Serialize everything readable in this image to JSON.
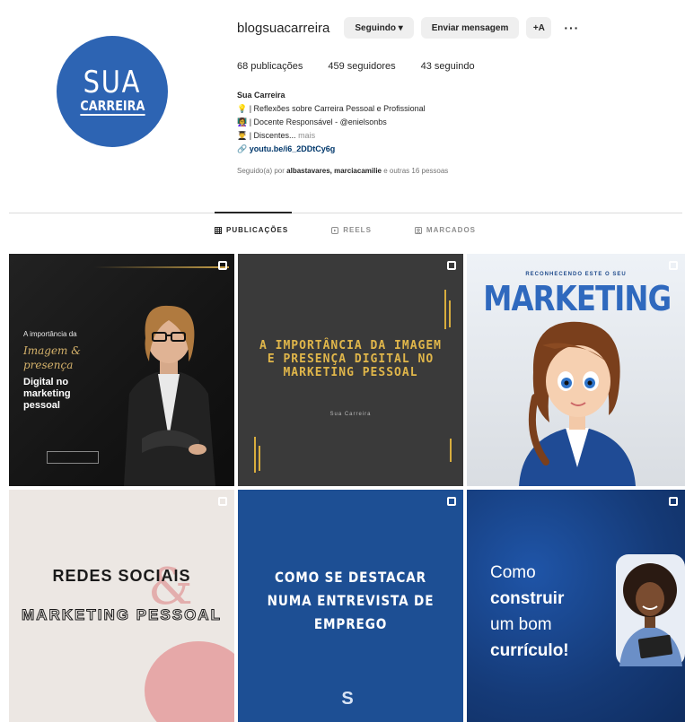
{
  "profile": {
    "avatar_top": "SUA",
    "avatar_bottom": "CARREIRA",
    "username": "blogsuacarreira",
    "following_btn": "Seguindo ▾",
    "message_btn": "Enviar mensagem",
    "add_user_icon": "+A",
    "more_icon": "···",
    "stats": {
      "posts": "68 publicações",
      "followers": "459 seguidores",
      "following": "43 seguindo"
    },
    "bio": {
      "name": "Sua Carreira",
      "line1": "💡 | Reflexões sobre Carreira Pessoal e Profissional",
      "line2": "👩‍🏫 | Docente Responsável - @enielsonbs",
      "line3_prefix": "👨‍🎓 | Discentes... ",
      "line3_more": "mais",
      "link": "🔗 youtu.be/i6_2DDtCy6g"
    },
    "followed_by_prefix": "Seguido(a) por ",
    "followed_by_names": "albastavares, marciacamilie",
    "followed_by_suffix": " e outras 16 pessoas"
  },
  "tabs": [
    {
      "label": "PUBLICAÇÕES",
      "icon": "grid-icon"
    },
    {
      "label": "REELS",
      "icon": "reels-icon"
    },
    {
      "label": "MARCADOS",
      "icon": "tagged-icon"
    }
  ],
  "posts": {
    "p1": {
      "small": "A importância da",
      "script": "Imagem & presença",
      "bold": "Digital no marketing pessoal"
    },
    "p2": {
      "title": "A IMPORTÂNCIA DA IMAGEM E PRESENÇA DIGITAL NO MARKETING PESSOAL",
      "sub": "Sua Carreira"
    },
    "p3": {
      "top": "RECONHECENDO ESTE O SEU",
      "big": "MARKETING"
    },
    "p4": {
      "title": "REDES SOCIAIS",
      "amp": "&",
      "mk": "MARKETING PESSOAL"
    },
    "p5": {
      "title": "COMO SE DESTACAR NUMA ENTREVISTA DE EMPREGO",
      "logo": "S"
    },
    "p6": {
      "line1": "Como",
      "line2": "construir",
      "line3": "um bom",
      "line4": "currículo!"
    }
  },
  "colors": {
    "brand_blue": "#2d64b3",
    "gold": "#d8ad3e",
    "link": "#00376b"
  }
}
